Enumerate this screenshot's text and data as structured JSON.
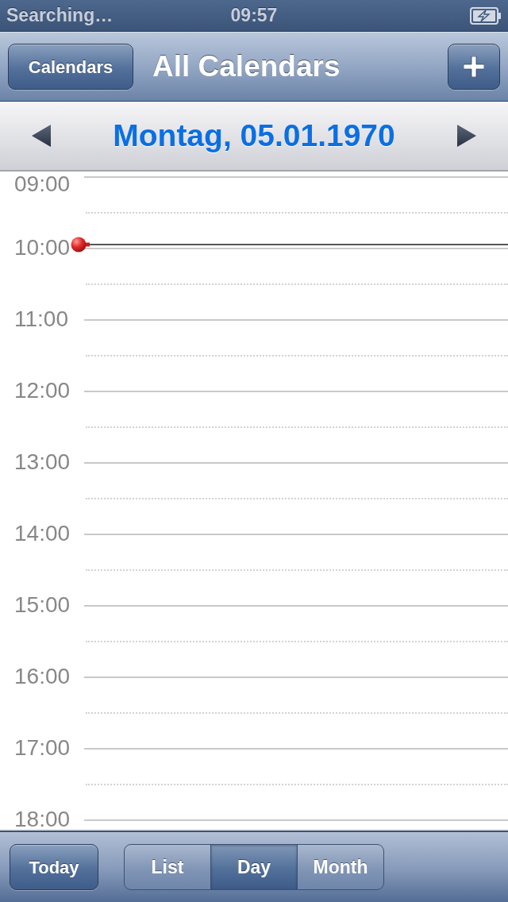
{
  "status_bar": {
    "network": "Searching…",
    "time": "09:57",
    "battery_charging": true
  },
  "nav_bar": {
    "left_button": "Calendars",
    "title": "All Calendars"
  },
  "date_bar": {
    "date": "Montag, 05.01.1970"
  },
  "timeline": {
    "hours": [
      {
        "label": "09:00",
        "now": false
      },
      {
        "label": "10:00",
        "now": true
      },
      {
        "label": "11:00",
        "now": false
      },
      {
        "label": "12:00",
        "now": false
      },
      {
        "label": "13:00",
        "now": false
      },
      {
        "label": "14:00",
        "now": false
      },
      {
        "label": "15:00",
        "now": false
      },
      {
        "label": "16:00",
        "now": false
      },
      {
        "label": "17:00",
        "now": false
      },
      {
        "label": "18:00",
        "now": false
      }
    ]
  },
  "toolbar": {
    "today_button": "Today",
    "view_modes": [
      {
        "label": "List",
        "selected": false
      },
      {
        "label": "Day",
        "selected": true
      },
      {
        "label": "Month",
        "selected": false
      }
    ]
  }
}
